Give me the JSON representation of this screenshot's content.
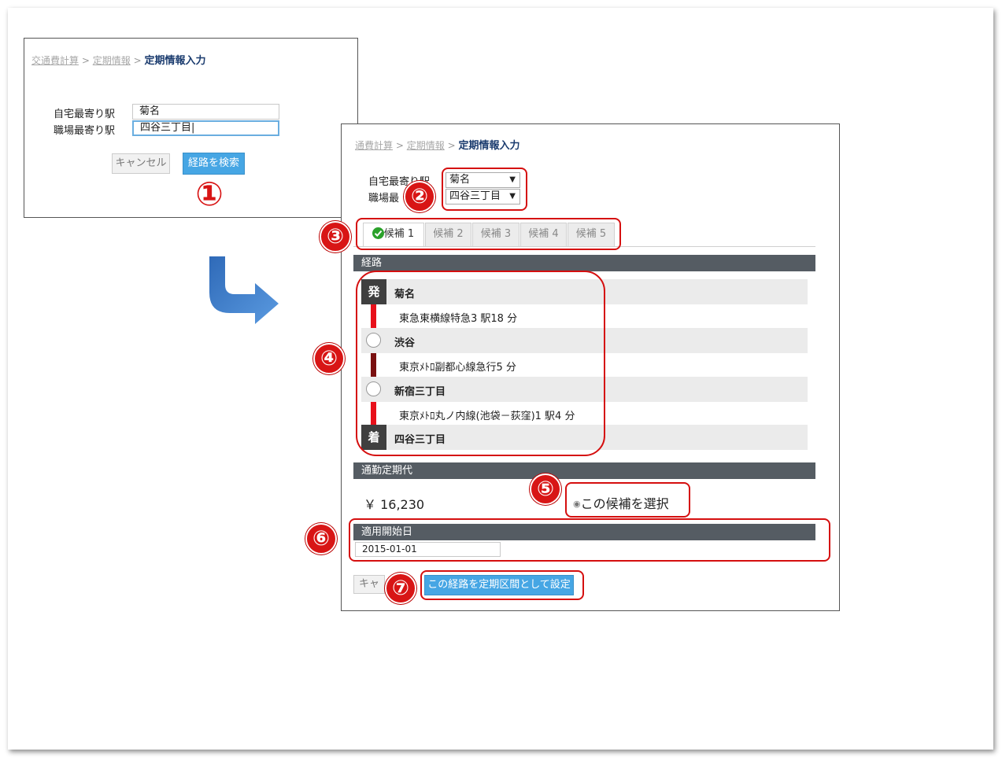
{
  "breadcrumb": {
    "item1": "交通費計算",
    "sep": ">",
    "item2": "定期情報",
    "current": "定期情報入力",
    "item1_clipped": "通費計算"
  },
  "form": {
    "home_label": "自宅最寄り駅",
    "home_value": "菊名",
    "work_label": "職場最寄り駅",
    "work_value": "四谷三丁目",
    "home_label_clipped": "自宅最寄り駅",
    "work_label_clipped": "職場最"
  },
  "buttons": {
    "cancel": "キャンセル",
    "search": "経路を検索",
    "cancel_clipped": "キャン",
    "set_route": "この経路を定期区間として設定"
  },
  "tabs": [
    "候補 1",
    "候補 2",
    "候補 3",
    "候補 4",
    "候補 5"
  ],
  "route": {
    "header": "経路",
    "depart_badge": "発",
    "arrive_badge": "着",
    "stations": [
      "菊名",
      "渋谷",
      "新宿三丁目",
      "四谷三丁目"
    ],
    "lines": [
      "東急東横線特急3 駅18 分",
      "東京ﾒﾄﾛ副都心線急行5 分",
      "東京ﾒﾄﾛ丸ノ内線(池袋－荻窪)1 駅4 分"
    ],
    "line_colors": [
      "#e8101a",
      "#7a1010",
      "#e8101a"
    ]
  },
  "fare": {
    "header": "通勤定期代",
    "amount": "￥ 16,230",
    "select_label": "この候補を選択"
  },
  "start_date": {
    "header": "適用開始日",
    "value": "2015-01-01"
  },
  "markers": [
    "①",
    "②",
    "③",
    "④",
    "⑤",
    "⑥",
    "⑦"
  ],
  "colors": {
    "accent_red": "#d50f0f",
    "button_blue": "#46a6e4",
    "arrow_blue": "#3a78c4",
    "header_gray": "#555c63"
  }
}
